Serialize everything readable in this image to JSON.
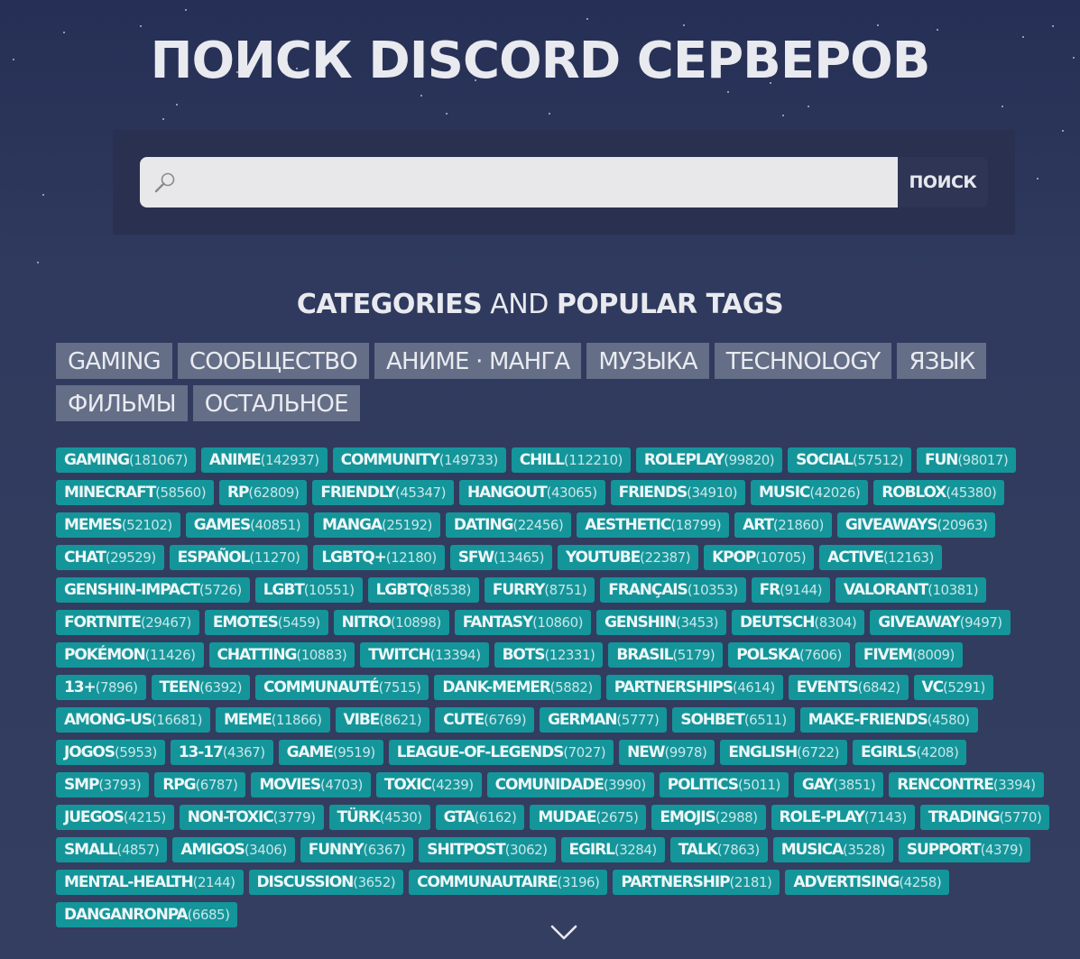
{
  "header": {
    "title": "ПОИСК DISCORD СЕРВЕРОВ"
  },
  "search": {
    "placeholder": "",
    "value": "",
    "button_label": "ПОИСК"
  },
  "section": {
    "heading_part1": "CATEGORIES",
    "heading_part2": "AND",
    "heading_part3": "POPULAR TAGS"
  },
  "categories": [
    "GAMING",
    "СООБЩЕСТВО",
    "АНИМЕ · МАНГА",
    "МУЗЫКА",
    "TECHNOLOGY",
    "ЯЗЫК",
    "ФИЛЬМЫ",
    "ОСТАЛЬНОЕ"
  ],
  "tags": [
    {
      "name": "GAMING",
      "count": "(181067)"
    },
    {
      "name": "ANIME",
      "count": "(142937)"
    },
    {
      "name": "COMMUNITY",
      "count": "(149733)"
    },
    {
      "name": "CHILL",
      "count": "(112210)"
    },
    {
      "name": "ROLEPLAY",
      "count": "(99820)"
    },
    {
      "name": "SOCIAL",
      "count": "(57512)"
    },
    {
      "name": "FUN",
      "count": "(98017)"
    },
    {
      "name": "MINECRAFT",
      "count": "(58560)"
    },
    {
      "name": "RP",
      "count": "(62809)"
    },
    {
      "name": "FRIENDLY",
      "count": "(45347)"
    },
    {
      "name": "HANGOUT",
      "count": "(43065)"
    },
    {
      "name": "FRIENDS",
      "count": "(34910)"
    },
    {
      "name": "MUSIC",
      "count": "(42026)"
    },
    {
      "name": "ROBLOX",
      "count": "(45380)"
    },
    {
      "name": "MEMES",
      "count": "(52102)"
    },
    {
      "name": "GAMES",
      "count": "(40851)"
    },
    {
      "name": "MANGA",
      "count": "(25192)"
    },
    {
      "name": "DATING",
      "count": "(22456)"
    },
    {
      "name": "AESTHETIC",
      "count": "(18799)"
    },
    {
      "name": "ART",
      "count": "(21860)"
    },
    {
      "name": "GIVEAWAYS",
      "count": "(20963)"
    },
    {
      "name": "CHAT",
      "count": "(29529)"
    },
    {
      "name": "ESPAÑOL",
      "count": "(11270)"
    },
    {
      "name": "LGBTQ+",
      "count": "(12180)"
    },
    {
      "name": "SFW",
      "count": "(13465)"
    },
    {
      "name": "YOUTUBE",
      "count": "(22387)"
    },
    {
      "name": "KPOP",
      "count": "(10705)"
    },
    {
      "name": "ACTIVE",
      "count": "(12163)"
    },
    {
      "name": "GENSHIN-IMPACT",
      "count": "(5726)"
    },
    {
      "name": "LGBT",
      "count": "(10551)"
    },
    {
      "name": "LGBTQ",
      "count": "(8538)"
    },
    {
      "name": "FURRY",
      "count": "(8751)"
    },
    {
      "name": "FRANÇAIS",
      "count": "(10353)"
    },
    {
      "name": "FR",
      "count": "(9144)"
    },
    {
      "name": "VALORANT",
      "count": "(10381)"
    },
    {
      "name": "FORTNITE",
      "count": "(29467)"
    },
    {
      "name": "EMOTES",
      "count": "(5459)"
    },
    {
      "name": "NITRO",
      "count": "(10898)"
    },
    {
      "name": "FANTASY",
      "count": "(10860)"
    },
    {
      "name": "GENSHIN",
      "count": "(3453)"
    },
    {
      "name": "DEUTSCH",
      "count": "(8304)"
    },
    {
      "name": "GIVEAWAY",
      "count": "(9497)"
    },
    {
      "name": "POKÉMON",
      "count": "(11426)"
    },
    {
      "name": "CHATTING",
      "count": "(10883)"
    },
    {
      "name": "TWITCH",
      "count": "(13394)"
    },
    {
      "name": "BOTS",
      "count": "(12331)"
    },
    {
      "name": "BRASIL",
      "count": "(5179)"
    },
    {
      "name": "POLSKA",
      "count": "(7606)"
    },
    {
      "name": "FIVEM",
      "count": "(8009)"
    },
    {
      "name": "13+",
      "count": "(7896)"
    },
    {
      "name": "TEEN",
      "count": "(6392)"
    },
    {
      "name": "COMMUNAUTÉ",
      "count": "(7515)"
    },
    {
      "name": "DANK-MEMER",
      "count": "(5882)"
    },
    {
      "name": "PARTNERSHIPS",
      "count": "(4614)"
    },
    {
      "name": "EVENTS",
      "count": "(6842)"
    },
    {
      "name": "VC",
      "count": "(5291)"
    },
    {
      "name": "AMONG-US",
      "count": "(16681)"
    },
    {
      "name": "MEME",
      "count": "(11866)"
    },
    {
      "name": "VIBE",
      "count": "(8621)"
    },
    {
      "name": "CUTE",
      "count": "(6769)"
    },
    {
      "name": "GERMAN",
      "count": "(5777)"
    },
    {
      "name": "SOHBET",
      "count": "(6511)"
    },
    {
      "name": "MAKE-FRIENDS",
      "count": "(4580)"
    },
    {
      "name": "JOGOS",
      "count": "(5953)"
    },
    {
      "name": "13-17",
      "count": "(4367)"
    },
    {
      "name": "GAME",
      "count": "(9519)"
    },
    {
      "name": "LEAGUE-OF-LEGENDS",
      "count": "(7027)"
    },
    {
      "name": "NEW",
      "count": "(9978)"
    },
    {
      "name": "ENGLISH",
      "count": "(6722)"
    },
    {
      "name": "EGIRLS",
      "count": "(4208)"
    },
    {
      "name": "SMP",
      "count": "(3793)"
    },
    {
      "name": "RPG",
      "count": "(6787)"
    },
    {
      "name": "MOVIES",
      "count": "(4703)"
    },
    {
      "name": "TOXIC",
      "count": "(4239)"
    },
    {
      "name": "COMUNIDADE",
      "count": "(3990)"
    },
    {
      "name": "POLITICS",
      "count": "(5011)"
    },
    {
      "name": "GAY",
      "count": "(3851)"
    },
    {
      "name": "RENCONTRE",
      "count": "(3394)"
    },
    {
      "name": "JUEGOS",
      "count": "(4215)"
    },
    {
      "name": "NON-TOXIC",
      "count": "(3779)"
    },
    {
      "name": "TÜRK",
      "count": "(4530)"
    },
    {
      "name": "GTA",
      "count": "(6162)"
    },
    {
      "name": "MUDAE",
      "count": "(2675)"
    },
    {
      "name": "EMOJIS",
      "count": "(2988)"
    },
    {
      "name": "ROLE-PLAY",
      "count": "(7143)"
    },
    {
      "name": "TRADING",
      "count": "(5770)"
    },
    {
      "name": "SMALL",
      "count": "(4857)"
    },
    {
      "name": "AMIGOS",
      "count": "(3406)"
    },
    {
      "name": "FUNNY",
      "count": "(6367)"
    },
    {
      "name": "SHITPOST",
      "count": "(3062)"
    },
    {
      "name": "EGIRL",
      "count": "(3284)"
    },
    {
      "name": "TALK",
      "count": "(7863)"
    },
    {
      "name": "MUSICA",
      "count": "(3528)"
    },
    {
      "name": "SUPPORT",
      "count": "(4379)"
    },
    {
      "name": "MENTAL-HEALTH",
      "count": "(2144)"
    },
    {
      "name": "DISCUSSION",
      "count": "(3652)"
    },
    {
      "name": "COMMUNAUTAIRE",
      "count": "(3196)"
    },
    {
      "name": "PARTNERSHIP",
      "count": "(2181)"
    },
    {
      "name": "ADVERTISING",
      "count": "(4258)"
    },
    {
      "name": "DANGANRONPA",
      "count": "(6685)"
    }
  ],
  "icons": {
    "search": "search-icon",
    "scroll_down": "chevron-down-icon"
  }
}
